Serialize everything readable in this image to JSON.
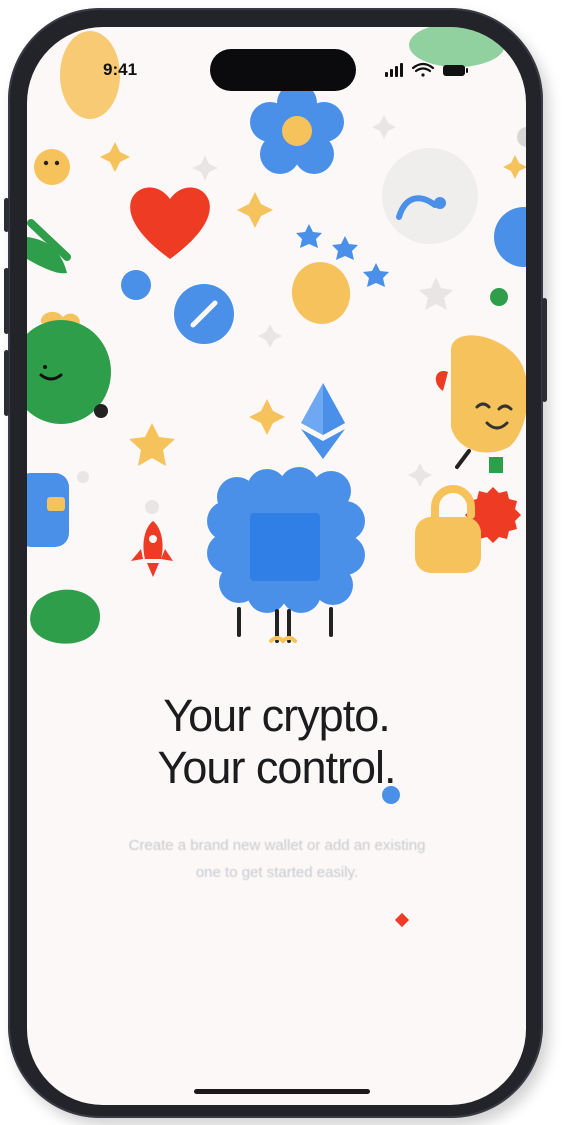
{
  "status_bar": {
    "time": "9:41",
    "icons": [
      "cellular-signal-icon",
      "wifi-icon",
      "battery-icon"
    ]
  },
  "onboarding": {
    "headline_line1": "Your crypto.",
    "headline_line2": "Your control.",
    "subtitle_line1": "Create a brand new wallet or add an existing",
    "subtitle_line2": "one to get started easily."
  },
  "illustration": {
    "elements": [
      "flower-icon",
      "heart-icon",
      "coin-icon",
      "ethereum-icon",
      "chip-character",
      "smiling-character",
      "padlock-icon",
      "rocket-icon",
      "sparkle-icon",
      "star-icon"
    ],
    "colors": {
      "blue": "#4a90e8",
      "light_blue": "#6ea8f2",
      "red": "#ee3b23",
      "yellow": "#f6c25c",
      "green": "#2f9e4a",
      "background": "#fbf8f7"
    }
  }
}
